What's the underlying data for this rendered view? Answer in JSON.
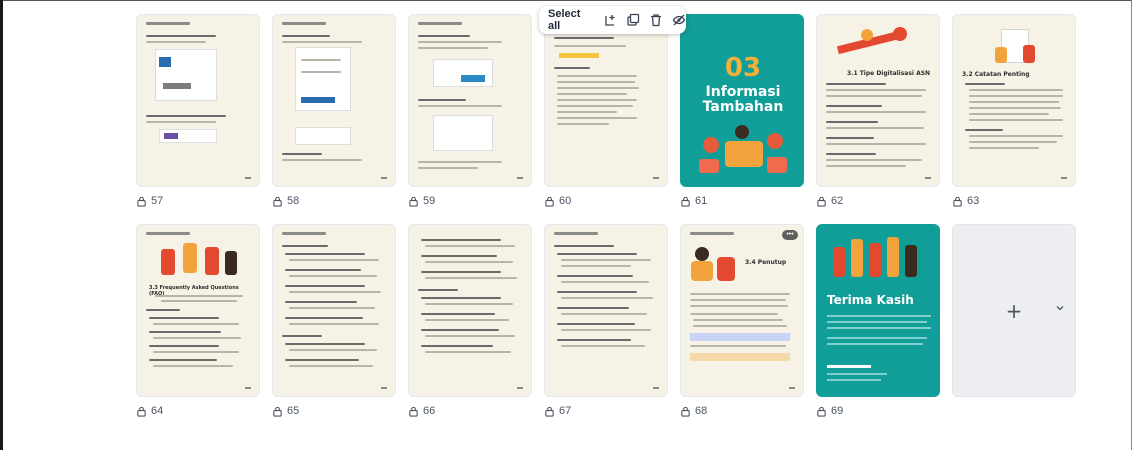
{
  "toolbar": {
    "select_all_label": "Select all",
    "icons": [
      "add-page-icon",
      "duplicate-icon",
      "trash-icon",
      "hide-icon"
    ]
  },
  "pages": [
    {
      "number": "57",
      "kind": "doc"
    },
    {
      "number": "58",
      "kind": "doc"
    },
    {
      "number": "59",
      "kind": "doc"
    },
    {
      "number": "60",
      "kind": "doc"
    },
    {
      "number": "61",
      "kind": "cover",
      "big_number": "03",
      "title": "Informasi Tambahan"
    },
    {
      "number": "62",
      "kind": "doc",
      "section": "3.1 Tipe Digitalisasi ASN"
    },
    {
      "number": "63",
      "kind": "doc",
      "section": "3.2 Catatan Penting"
    },
    {
      "number": "64",
      "kind": "doc",
      "section": "3.3 Frequently Asked Questions (FAQ)"
    },
    {
      "number": "65",
      "kind": "doc"
    },
    {
      "number": "66",
      "kind": "doc"
    },
    {
      "number": "67",
      "kind": "doc"
    },
    {
      "number": "68",
      "kind": "doc",
      "section": "3.4 Penutup"
    },
    {
      "number": "69",
      "kind": "closing",
      "title": "Terima Kasih"
    }
  ],
  "add_page": {
    "icon": "plus-icon"
  },
  "colors": {
    "teal": "#119e98",
    "accent_orange": "#f0b23a",
    "doc_bg": "#f6f2e6"
  }
}
